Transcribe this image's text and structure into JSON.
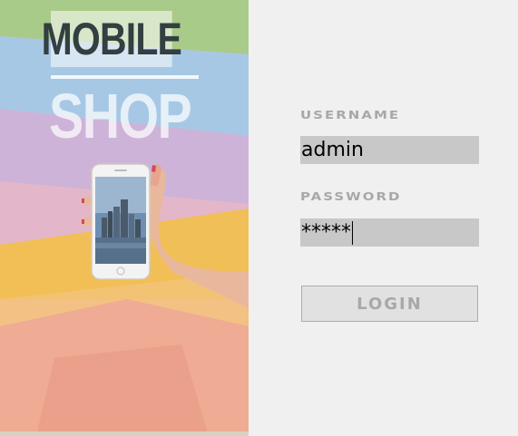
{
  "branding": {
    "logo_line1": "MOBILE",
    "logo_line2": "SHOP"
  },
  "login_form": {
    "username_label": "USERNAME",
    "username_value": "admin",
    "password_label": "PASSWORD",
    "password_value": "*****",
    "login_button_label": "LOGIN"
  },
  "colors": {
    "form_background": "#f0f0f0",
    "field_background": "#c8c8c8",
    "label_color": "#a8a8a8",
    "button_background": "#e1e1e1"
  }
}
